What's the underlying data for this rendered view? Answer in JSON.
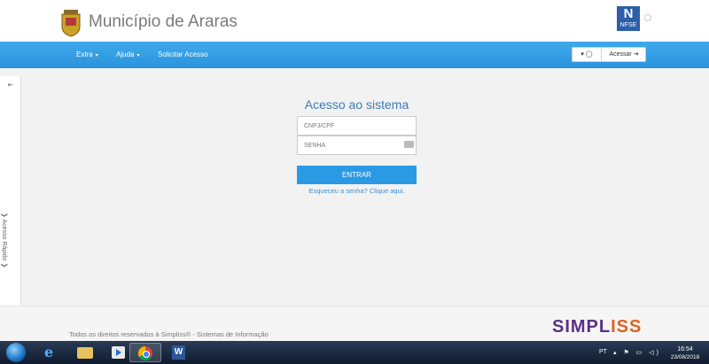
{
  "header": {
    "title": "Município de Araras",
    "crest_icon": "coat-of-arms-icon",
    "badge": {
      "letter": "N",
      "text": "NFSE"
    }
  },
  "nav": {
    "items": [
      {
        "label": "Extra",
        "caret": "▾"
      },
      {
        "label": "Ajuda",
        "caret": "▾"
      },
      {
        "label": "Solicitar Acesso"
      }
    ],
    "lang_label": "▾ ◯",
    "access_label": "Acessar ⇥"
  },
  "sidebar": {
    "pin": "⇤",
    "label": "❯ Acesso Rápido ❯"
  },
  "login": {
    "title": "Acesso ao sistema",
    "cpf_placeholder": "CNPJ/CPF",
    "password_placeholder": "SENHA",
    "submit_label": "ENTRAR",
    "forgot_label": "Esqueceu a senha? Clique aqui."
  },
  "footer": {
    "text": "Todos os direitos reservados à Simpliss® - Sistemas de Informação",
    "brand_main": "SIMPL",
    "brand_ss": "ISS"
  },
  "taskbar": {
    "word_letter": "W",
    "lang": "PT",
    "tray": "▴ ⚑ ▭ ◁)",
    "time": "16:54",
    "date": "23/08/2018"
  },
  "colors": {
    "nav": "#2a93dc",
    "title": "#3a7cb8",
    "button": "#2a9ae4",
    "brand": "#5b2f86",
    "brand_accent": "#e1621e"
  }
}
